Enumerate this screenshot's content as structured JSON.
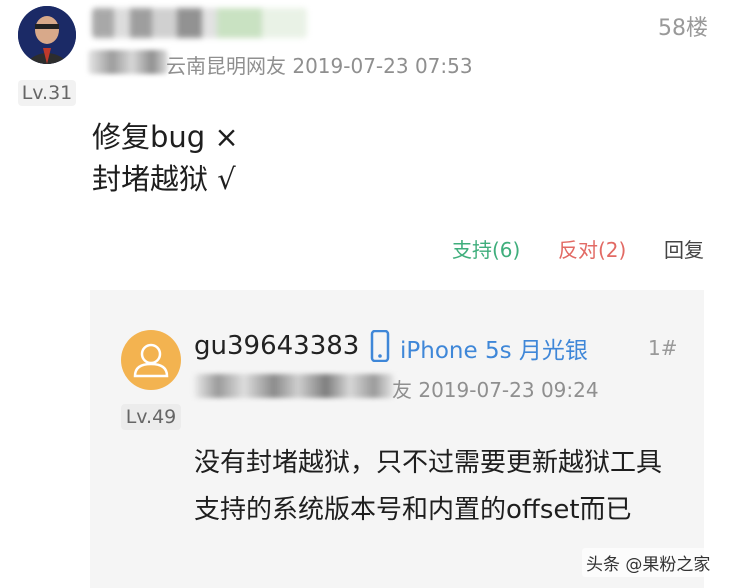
{
  "post": {
    "level": "Lv.31",
    "floor": "58楼",
    "location_tail": "云南昆明网友",
    "time": "2019-07-23 07:53",
    "content_lines": [
      "修复bug ×",
      "封堵越狱 √"
    ],
    "actions": {
      "support": "支持(6)",
      "oppose": "反对(2)",
      "reply": "回复"
    }
  },
  "reply": {
    "username": "gu39643383",
    "device": "iPhone 5s 月光银",
    "floor": "1#",
    "level": "Lv.49",
    "location_tail": "友",
    "time": "2019-07-23 09:24",
    "content": "没有封堵越狱，只不过需要更新越狱工具支持的系统版本号和内置的offset而已"
  },
  "watermark": "头条 @果粉之家",
  "colors": {
    "support": "#3fae7c",
    "oppose": "#e26a64",
    "device_link": "#3f87d8",
    "reply_bg": "#f5f5f5",
    "reply_avatar": "#f3b350"
  },
  "icons": {
    "phone": "phone-icon",
    "default_avatar": "user-silhouette-icon"
  }
}
